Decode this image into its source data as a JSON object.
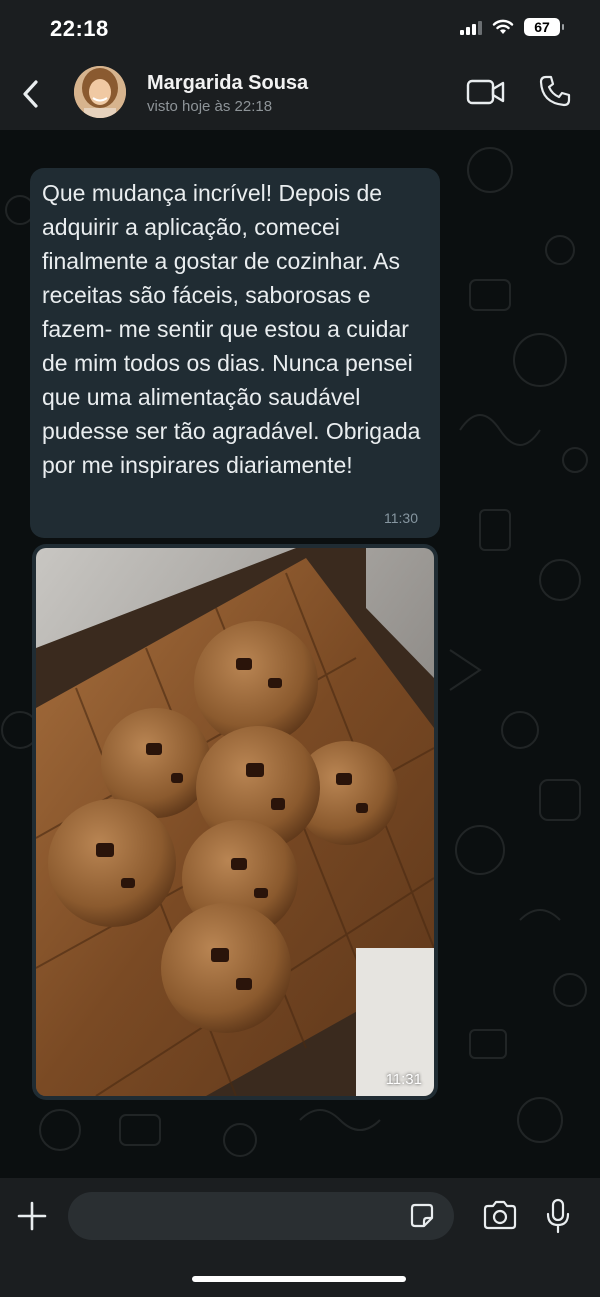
{
  "status_bar": {
    "time": "22:18",
    "battery": "67",
    "icons": [
      "signal-icon",
      "wifi-icon",
      "battery-icon"
    ]
  },
  "header": {
    "contact_name": "Margarida Sousa",
    "contact_status": "visto hoje às 22:18",
    "icons": [
      "back-chevron-icon",
      "video-call-icon",
      "phone-call-icon"
    ]
  },
  "messages": [
    {
      "type": "text",
      "text": "Que mudança incrível! Depois de adquirir a aplicação, comecei finalmente a gostar de cozinhar. As receitas são fáceis, saborosas e fazem- me sentir que estou a cuidar de mim todos os dias. Nunca pensei que uma alimentação saudável pudesse ser tão agradável. Obrigada por me inspirares diariamente!",
      "time": "11:30"
    },
    {
      "type": "image",
      "time": "11:31"
    }
  ],
  "input_bar": {
    "placeholder": "",
    "icons": [
      "plus-icon",
      "sticker-icon",
      "camera-icon",
      "microphone-icon"
    ]
  },
  "colors": {
    "background": "#0b0f10",
    "bar": "#1b1e20",
    "bubble": "#202c33",
    "text": "#e9edef",
    "meta": "#8696a0"
  }
}
